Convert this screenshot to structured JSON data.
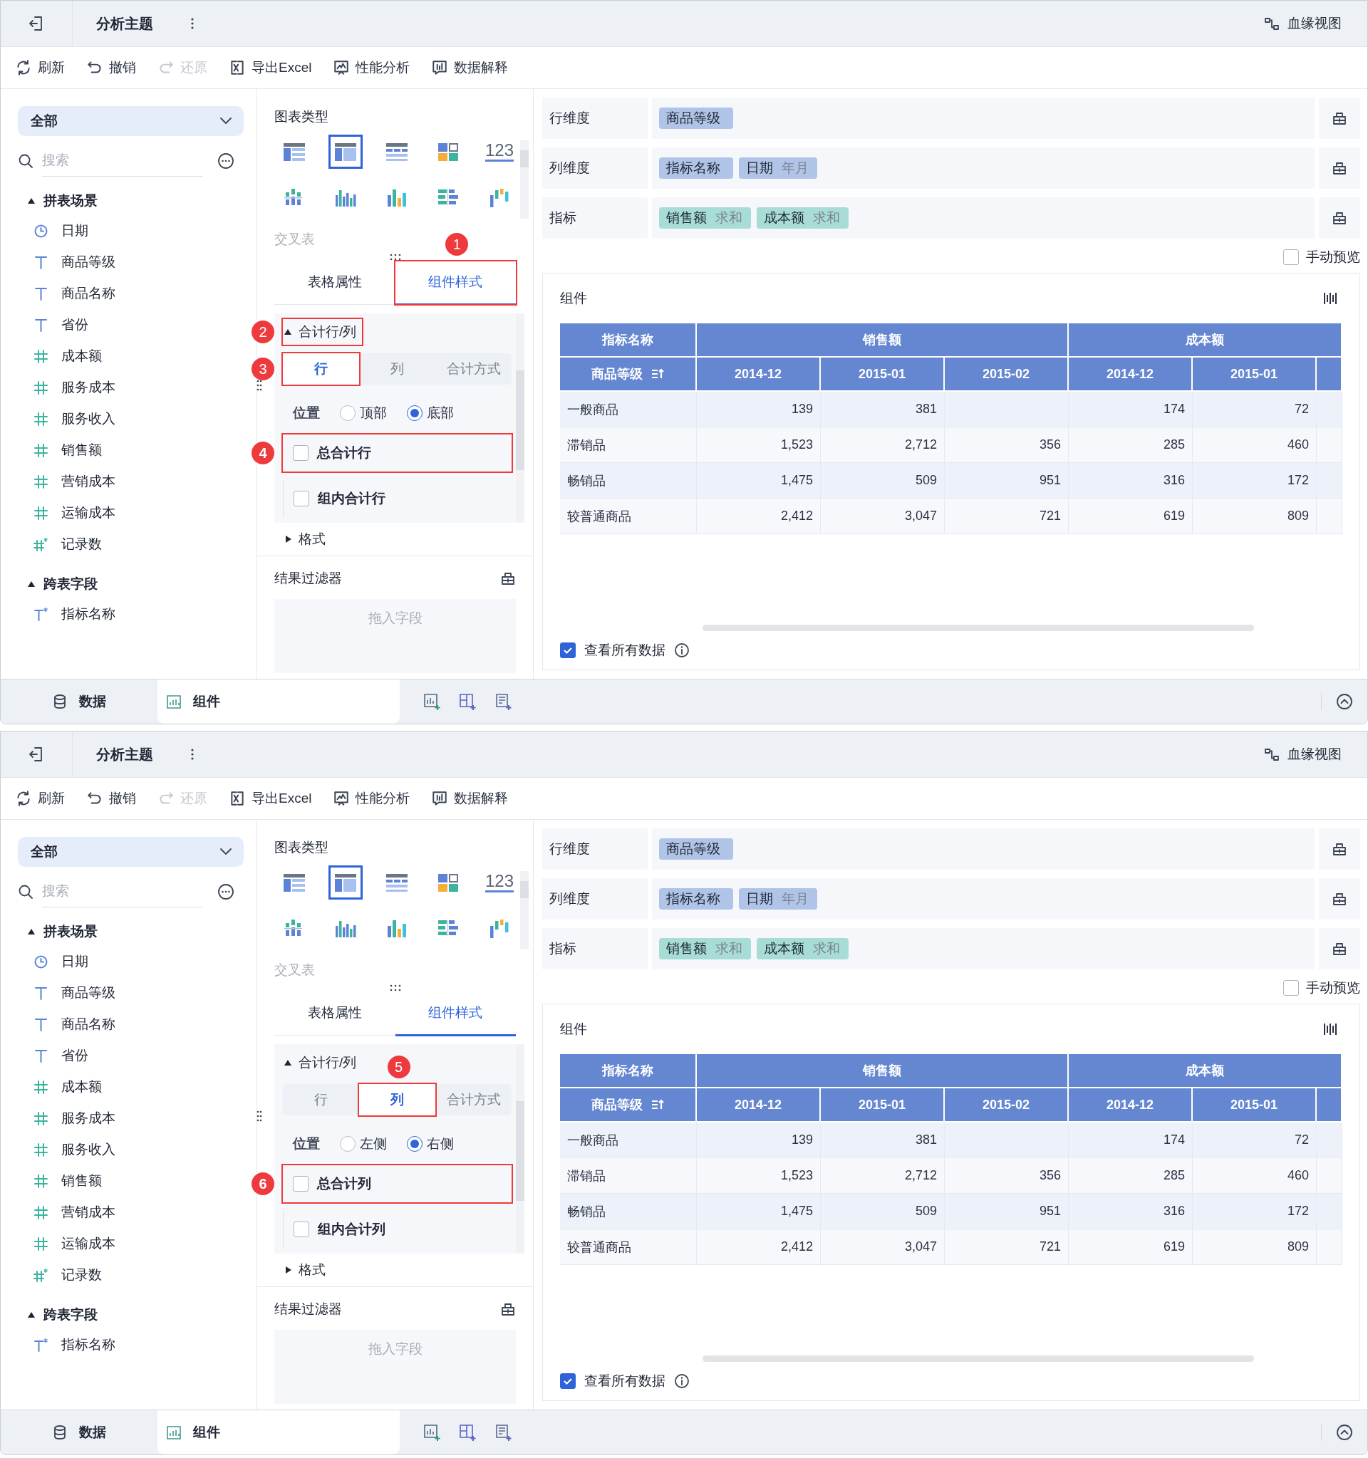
{
  "panels": [
    {
      "title_bar": {
        "title": "分析主题",
        "lineage": "血缘视图"
      },
      "toolbar": [
        {
          "label": "刷新",
          "kind": "refresh",
          "disabled": false
        },
        {
          "label": "撤销",
          "kind": "undo",
          "disabled": false
        },
        {
          "label": "还原",
          "kind": "redo",
          "disabled": true
        },
        {
          "label": "导出Excel",
          "kind": "export",
          "disabled": false
        },
        {
          "label": "性能分析",
          "kind": "performance",
          "disabled": false
        },
        {
          "label": "数据解释",
          "kind": "explain",
          "disabled": false
        }
      ],
      "sidebar": {
        "scope": "全部",
        "search_placeholder": "搜索",
        "groups": [
          {
            "label": "拼表场景",
            "expanded": true,
            "children": [
              {
                "label": "日期",
                "kind": "date"
              },
              {
                "label": "商品等级",
                "kind": "text"
              },
              {
                "label": "商品名称",
                "kind": "text"
              },
              {
                "label": "省份",
                "kind": "text"
              },
              {
                "label": "成本额",
                "kind": "number"
              },
              {
                "label": "服务成本",
                "kind": "number"
              },
              {
                "label": "服务收入",
                "kind": "number"
              },
              {
                "label": "销售额",
                "kind": "number"
              },
              {
                "label": "营销成本",
                "kind": "number"
              },
              {
                "label": "运输成本",
                "kind": "number"
              },
              {
                "label": "记录数",
                "kind": "number-calc"
              }
            ]
          },
          {
            "label": "跨表字段",
            "expanded": true,
            "children": [
              {
                "label": "指标名称",
                "kind": "text-calc"
              }
            ]
          }
        ]
      },
      "chart_types": {
        "title": "图表类型",
        "caption": "交叉表",
        "items": [
          {
            "kind": "detail-table",
            "selected": false
          },
          {
            "kind": "cross-table",
            "selected": true
          },
          {
            "kind": "group-table",
            "selected": false
          },
          {
            "kind": "blocks",
            "selected": false
          },
          {
            "kind": "number",
            "label": "123",
            "selected": false
          },
          {
            "kind": "scatter-bars",
            "selected": false
          },
          {
            "kind": "grouped-bars",
            "selected": false
          },
          {
            "kind": "color-bars",
            "selected": false
          },
          {
            "kind": "horizontal-bars",
            "selected": false
          },
          {
            "kind": "waterfall",
            "selected": false
          }
        ]
      },
      "config_tabs": [
        {
          "label": "表格属性",
          "selected": false
        },
        {
          "label": "组件样式",
          "selected": true,
          "callout": {
            "number": "1",
            "kind": "above"
          }
        }
      ],
      "totals_section": {
        "title": "合计行/列",
        "expanded": true,
        "callout": {
          "number": "2",
          "kind": "left"
        },
        "segments": [
          {
            "label": "行",
            "selected": true,
            "callout": {
              "number": "3",
              "kind": "left"
            }
          },
          {
            "label": "列",
            "selected": false
          },
          {
            "label": "合计方式",
            "selected": false
          }
        ],
        "position": {
          "label": "位置",
          "options": [
            {
              "label": "顶部",
              "selected": false
            },
            {
              "label": "底部",
              "selected": true
            }
          ]
        },
        "checkboxes": [
          {
            "label": "总合计行",
            "checked": false,
            "callout": {
              "number": "4",
              "kind": "left"
            }
          },
          {
            "label": "组内合计行",
            "checked": false
          }
        ]
      },
      "format_section": {
        "title": "格式",
        "expanded": false
      },
      "result_filter": {
        "title": "结果过滤器",
        "placeholder": "拖入字段"
      },
      "fields": [
        {
          "label": "行维度",
          "chips": [
            {
              "label": "商品等级",
              "kind": "dimension"
            }
          ]
        },
        {
          "label": "列维度",
          "chips": [
            {
              "label": "指标名称",
              "kind": "dimension"
            },
            {
              "label": "日期",
              "sub": "年月",
              "kind": "dimension"
            }
          ]
        },
        {
          "label": "指标",
          "chips": [
            {
              "label": "销售额",
              "sub": "求和",
              "kind": "measure"
            },
            {
              "label": "成本额",
              "sub": "求和",
              "kind": "measure"
            }
          ]
        }
      ],
      "manual_preview": {
        "label": "手动预览",
        "checked": false
      },
      "component": {
        "title": "组件",
        "table": {
          "header_top": [
            "指标名称",
            "销售额",
            "成本额"
          ],
          "corner": "商品等级",
          "columns": [
            "2014-12",
            "2015-01",
            "2015-02",
            "2014-12",
            "2015-01"
          ],
          "rows": [
            {
              "label": "一般商品",
              "cells": [
                {
                  "value": "139"
                },
                {
                  "value": "381"
                },
                {},
                {
                  "value": "174"
                },
                {
                  "value": "72"
                }
              ]
            },
            {
              "label": "滞销品",
              "cells": [
                {
                  "value": "1,523"
                },
                {
                  "value": "2,712"
                },
                {
                  "value": "356"
                },
                {
                  "value": "285"
                },
                {
                  "value": "460"
                }
              ]
            },
            {
              "label": "畅销品",
              "cells": [
                {
                  "value": "1,475"
                },
                {
                  "value": "509"
                },
                {
                  "value": "951"
                },
                {
                  "value": "316"
                },
                {
                  "value": "172"
                }
              ]
            },
            {
              "label": "较普通商品",
              "cells": [
                {
                  "value": "2,412"
                },
                {
                  "value": "3,047"
                },
                {
                  "value": "721"
                },
                {
                  "value": "619"
                },
                {
                  "value": "809"
                }
              ]
            }
          ]
        },
        "view_all": {
          "label": "查看所有数据",
          "checked": true
        }
      },
      "bottom_tabs": [
        {
          "label": "数据",
          "kind": "data",
          "selected": false
        },
        {
          "label": "组件",
          "kind": "component",
          "selected": true
        }
      ]
    },
    {
      "title_bar": {
        "title": "分析主题",
        "lineage": "血缘视图"
      },
      "toolbar": [
        {
          "label": "刷新",
          "kind": "refresh",
          "disabled": false
        },
        {
          "label": "撤销",
          "kind": "undo",
          "disabled": false
        },
        {
          "label": "还原",
          "kind": "redo",
          "disabled": true
        },
        {
          "label": "导出Excel",
          "kind": "export",
          "disabled": false
        },
        {
          "label": "性能分析",
          "kind": "performance",
          "disabled": false
        },
        {
          "label": "数据解释",
          "kind": "explain",
          "disabled": false
        }
      ],
      "sidebar": {
        "scope": "全部",
        "search_placeholder": "搜索",
        "groups": [
          {
            "label": "拼表场景",
            "expanded": true,
            "children": [
              {
                "label": "日期",
                "kind": "date"
              },
              {
                "label": "商品等级",
                "kind": "text"
              },
              {
                "label": "商品名称",
                "kind": "text"
              },
              {
                "label": "省份",
                "kind": "text"
              },
              {
                "label": "成本额",
                "kind": "number"
              },
              {
                "label": "服务成本",
                "kind": "number"
              },
              {
                "label": "服务收入",
                "kind": "number"
              },
              {
                "label": "销售额",
                "kind": "number"
              },
              {
                "label": "营销成本",
                "kind": "number"
              },
              {
                "label": "运输成本",
                "kind": "number"
              },
              {
                "label": "记录数",
                "kind": "number-calc"
              }
            ]
          },
          {
            "label": "跨表字段",
            "expanded": true,
            "children": [
              {
                "label": "指标名称",
                "kind": "text-calc"
              }
            ]
          }
        ]
      },
      "chart_types": {
        "title": "图表类型",
        "caption": "交叉表",
        "items": [
          {
            "kind": "detail-table",
            "selected": false
          },
          {
            "kind": "cross-table",
            "selected": true
          },
          {
            "kind": "group-table",
            "selected": false
          },
          {
            "kind": "blocks",
            "selected": false
          },
          {
            "kind": "number",
            "label": "123",
            "selected": false
          },
          {
            "kind": "scatter-bars",
            "selected": false
          },
          {
            "kind": "grouped-bars",
            "selected": false
          },
          {
            "kind": "color-bars",
            "selected": false
          },
          {
            "kind": "horizontal-bars",
            "selected": false
          },
          {
            "kind": "waterfall",
            "selected": false
          }
        ]
      },
      "config_tabs": [
        {
          "label": "表格属性",
          "selected": false
        },
        {
          "label": "组件样式",
          "selected": true
        }
      ],
      "totals_section": {
        "title": "合计行/列",
        "expanded": true,
        "segments": [
          {
            "label": "行",
            "selected": false
          },
          {
            "label": "列",
            "selected": true,
            "callout": {
              "number": "5",
              "kind": "above"
            }
          },
          {
            "label": "合计方式",
            "selected": false
          }
        ],
        "position": {
          "label": "位置",
          "options": [
            {
              "label": "左侧",
              "selected": false
            },
            {
              "label": "右侧",
              "selected": true
            }
          ]
        },
        "checkboxes": [
          {
            "label": "总合计列",
            "checked": false,
            "callout": {
              "number": "6",
              "kind": "left"
            }
          },
          {
            "label": "组内合计列",
            "checked": false
          }
        ]
      },
      "format_section": {
        "title": "格式",
        "expanded": false
      },
      "result_filter": {
        "title": "结果过滤器",
        "placeholder": "拖入字段"
      },
      "fields": [
        {
          "label": "行维度",
          "chips": [
            {
              "label": "商品等级",
              "kind": "dimension"
            }
          ]
        },
        {
          "label": "列维度",
          "chips": [
            {
              "label": "指标名称",
              "kind": "dimension"
            },
            {
              "label": "日期",
              "sub": "年月",
              "kind": "dimension"
            }
          ]
        },
        {
          "label": "指标",
          "chips": [
            {
              "label": "销售额",
              "sub": "求和",
              "kind": "measure"
            },
            {
              "label": "成本额",
              "sub": "求和",
              "kind": "measure"
            }
          ]
        }
      ],
      "manual_preview": {
        "label": "手动预览",
        "checked": false
      },
      "component": {
        "title": "组件",
        "table": {
          "header_top": [
            "指标名称",
            "销售额",
            "成本额"
          ],
          "corner": "商品等级",
          "columns": [
            "2014-12",
            "2015-01",
            "2015-02",
            "2014-12",
            "2015-01"
          ],
          "rows": [
            {
              "label": "一般商品",
              "cells": [
                {
                  "value": "139"
                },
                {
                  "value": "381"
                },
                {},
                {
                  "value": "174"
                },
                {
                  "value": "72"
                }
              ]
            },
            {
              "label": "滞销品",
              "cells": [
                {
                  "value": "1,523"
                },
                {
                  "value": "2,712"
                },
                {
                  "value": "356"
                },
                {
                  "value": "285"
                },
                {
                  "value": "460"
                }
              ]
            },
            {
              "label": "畅销品",
              "cells": [
                {
                  "value": "1,475"
                },
                {
                  "value": "509"
                },
                {
                  "value": "951"
                },
                {
                  "value": "316"
                },
                {
                  "value": "172"
                }
              ]
            },
            {
              "label": "较普通商品",
              "cells": [
                {
                  "value": "2,412"
                },
                {
                  "value": "3,047"
                },
                {
                  "value": "721"
                },
                {
                  "value": "619"
                },
                {
                  "value": "809"
                }
              ]
            }
          ]
        },
        "view_all": {
          "label": "查看所有数据",
          "checked": true
        }
      },
      "bottom_tabs": [
        {
          "label": "数据",
          "kind": "data",
          "selected": false
        },
        {
          "label": "组件",
          "kind": "component",
          "selected": true
        }
      ]
    }
  ]
}
